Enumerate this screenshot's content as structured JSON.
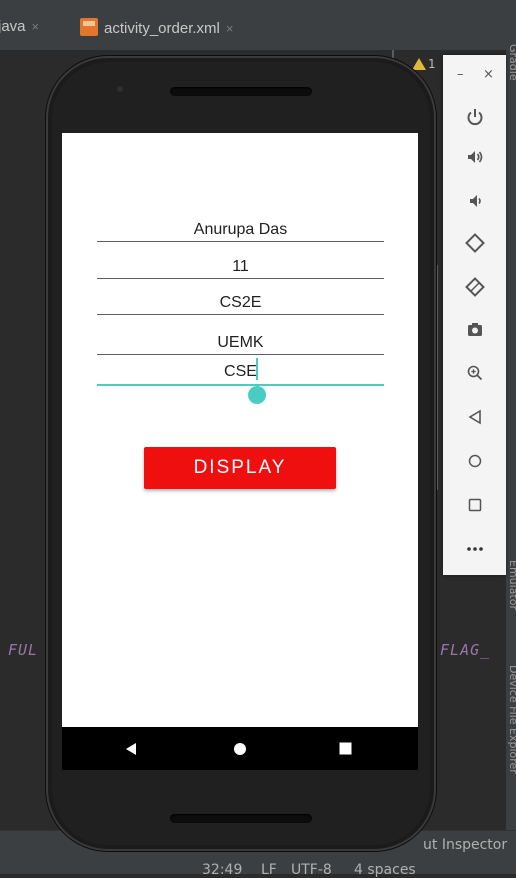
{
  "ide": {
    "tabs": [
      {
        "label": "java",
        "close": "×"
      },
      {
        "label": "activity_order.xml",
        "close": "×"
      }
    ],
    "warning_count": "1",
    "code_fragments": {
      "left": "FUL",
      "right": ".FLAG_"
    },
    "side_labels": {
      "top": "Gradle",
      "middle": "Emulator",
      "bottom": "Device File Explorer"
    },
    "status": {
      "inspector": "ut Inspector",
      "position": "32:49",
      "line_ending": "LF",
      "encoding": "UTF-8",
      "indent": "4 spaces"
    }
  },
  "emulator_panel": {
    "minimize": "–",
    "close": "×",
    "buttons": [
      "power",
      "volume-up",
      "volume-down",
      "rotate-left",
      "rotate-right",
      "screenshot",
      "zoom",
      "back",
      "home",
      "overview",
      "more"
    ]
  },
  "app": {
    "fields": [
      {
        "name": "name",
        "value": "Anurupa Das"
      },
      {
        "name": "roll",
        "value": "11"
      },
      {
        "name": "section",
        "value": "CS2E"
      },
      {
        "name": "university",
        "value": "UEMK"
      },
      {
        "name": "department",
        "value": "CSE"
      }
    ],
    "display_button": "DISPLAY",
    "accent_color": "#49cdc2",
    "button_color": "#ef0f0f"
  }
}
